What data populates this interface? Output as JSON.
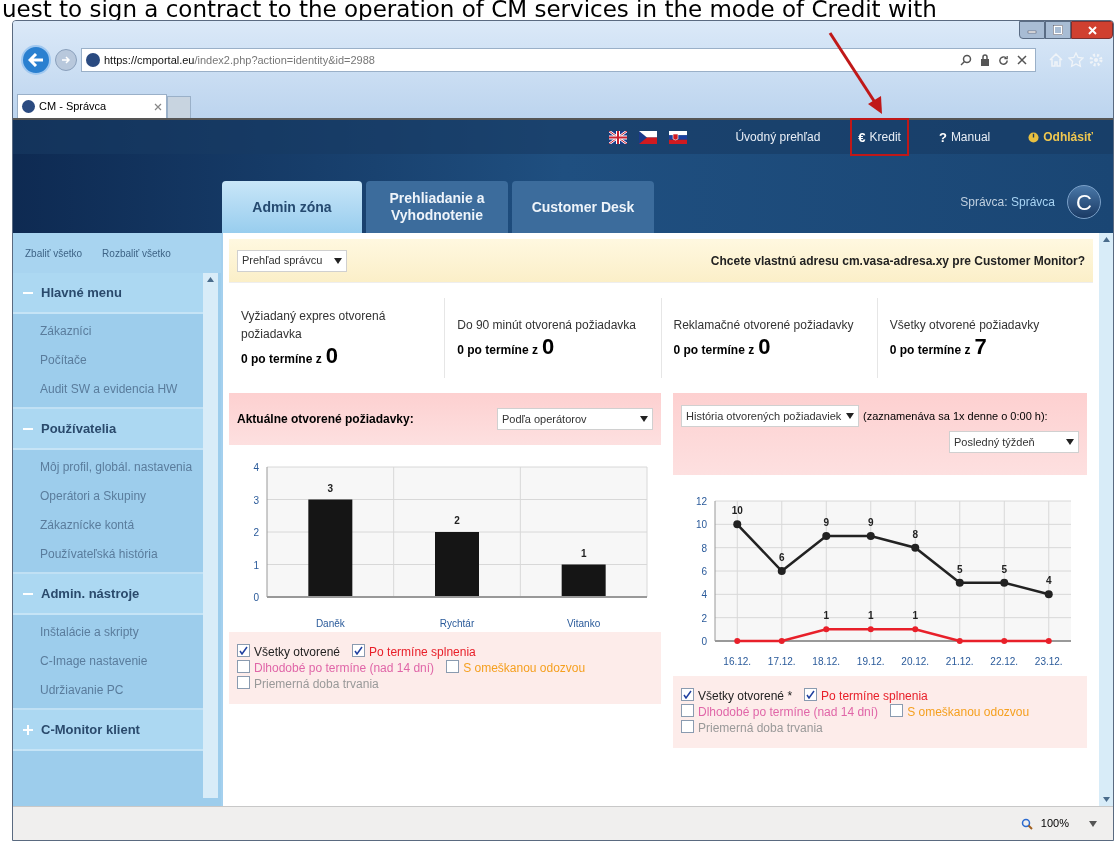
{
  "caption": "uest to sign a contract to the operation of CM services in the mode of Credit with",
  "browser": {
    "url_host": "https://cmportal.eu",
    "url_path": "/index2.php?action=identity&id=2988",
    "tab_title": "CM - Správca",
    "zoom": "100%"
  },
  "header": {
    "links": [
      {
        "kind": "plain",
        "label": "Úvodný prehľad"
      },
      {
        "kind": "credit",
        "icon": "€",
        "label": "Kredit",
        "highlighted": true
      },
      {
        "kind": "help",
        "icon": "?",
        "label": "Manual"
      },
      {
        "kind": "logout",
        "label": "Odhlásiť"
      }
    ],
    "user_label": "Správca:",
    "user_name": "Správca",
    "logo_letter": "C"
  },
  "tabs": [
    {
      "label": "Admin zóna",
      "selected": true
    },
    {
      "label": "Prehliadanie a Vyhodnotenie",
      "selected": false
    },
    {
      "label": "Customer Desk",
      "selected": false
    }
  ],
  "sidebar": {
    "collapse_all": "Zbaliť všetko",
    "expand_all": "Rozbaliť všetko",
    "sections": [
      {
        "title": "Hlavné menu",
        "expanded": true,
        "items": [
          "Zákazníci",
          "Počítače",
          "Audit SW a evidencia HW"
        ]
      },
      {
        "title": "Používatelia",
        "expanded": true,
        "items": [
          "Môj profil, globál. nastavenia",
          "Operátori a Skupiny",
          "Zákaznícke kontá",
          "Používateľská história"
        ]
      },
      {
        "title": "Admin. nástroje",
        "expanded": true,
        "items": [
          "Inštalácie a skripty",
          "C-Image nastavenie",
          "Udržiavanie PC"
        ]
      },
      {
        "title": "C-Monitor klient",
        "expanded": false
      }
    ]
  },
  "banner": {
    "select": "Prehľad správcu",
    "question": "Chcete vlastnú adresu cm.vasa-adresa.xy pre Customer Monitor?"
  },
  "stats": [
    {
      "label": "Vyžiadaný expres otvorená požiadavka",
      "overdue": "0 po termíne z",
      "total": "0"
    },
    {
      "label": "Do 90 minút otvorená požiadavka",
      "overdue": "0 po termíne z",
      "total": "0"
    },
    {
      "label": "Reklamačné otvorené požiadavky",
      "overdue": "0 po termíne z",
      "total": "0"
    },
    {
      "label": "Všetky otvorené požiadavky",
      "overdue": "0 po termíne z",
      "total": "7"
    }
  ],
  "left_panel": {
    "title": "Aktuálne otvorené požiadavky:",
    "select": "Podľa operátorov",
    "chart_data": {
      "type": "bar",
      "categories": [
        "Daněk",
        "Rychtár",
        "Vitanko"
      ],
      "values": [
        3,
        2,
        1
      ],
      "ylim": [
        0,
        4
      ],
      "yticks": [
        0,
        1,
        2,
        3,
        4
      ],
      "grid": true,
      "data_labels": true
    },
    "legend": [
      {
        "label": "Všetky otvorené",
        "checked": true,
        "color": "#222222"
      },
      {
        "label": "Po termíne splnenia",
        "checked": true,
        "color": "#e8202a"
      },
      {
        "label": "Dlhodobé po termíne (nad 14 dní)",
        "checked": false,
        "color": "#e066a8"
      },
      {
        "label": "S omeškanou odozvou",
        "checked": false,
        "color": "#f5a020"
      },
      {
        "label": "Priemerná doba trvania",
        "checked": false,
        "color": "#999999"
      }
    ]
  },
  "right_panel": {
    "select": "História otvorených požiadaviek",
    "note": "(zaznamenáva sa 1x denne o 0:00 h):",
    "period": "Posledný týždeň",
    "chart_data": {
      "type": "line",
      "categories": [
        "16.12.",
        "17.12.",
        "18.12.",
        "19.12.",
        "20.12.",
        "21.12.",
        "22.12.",
        "23.12."
      ],
      "series": [
        {
          "color": "#222222",
          "marker": "circle",
          "values": [
            10,
            6,
            9,
            9,
            8,
            5,
            5,
            4
          ],
          "value_labels": [
            "10",
            "6",
            "9",
            "9",
            "8",
            "5",
            "5",
            "4"
          ]
        },
        {
          "color": "#e8202a",
          "marker": "circle",
          "values": [
            0,
            0,
            1,
            1,
            1,
            0,
            0,
            0
          ],
          "value_labels": [
            null,
            null,
            "1",
            "1",
            "1",
            null,
            null,
            null
          ]
        }
      ],
      "ylim": [
        0,
        12
      ],
      "yticks": [
        0,
        2,
        4,
        6,
        8,
        10,
        12
      ],
      "grid": true
    },
    "legend": [
      {
        "label": "Všetky otvorené *",
        "checked": true,
        "color": "#222222"
      },
      {
        "label": "Po termíne splnenia",
        "checked": true,
        "color": "#e8202a"
      },
      {
        "label": "Dlhodobé po termíne (nad 14 dní)",
        "checked": false,
        "color": "#e066a8"
      },
      {
        "label": "S omeškanou odozvou",
        "checked": false,
        "color": "#f5a020"
      },
      {
        "label": "Priemerná doba trvania",
        "checked": false,
        "color": "#999999"
      }
    ]
  }
}
